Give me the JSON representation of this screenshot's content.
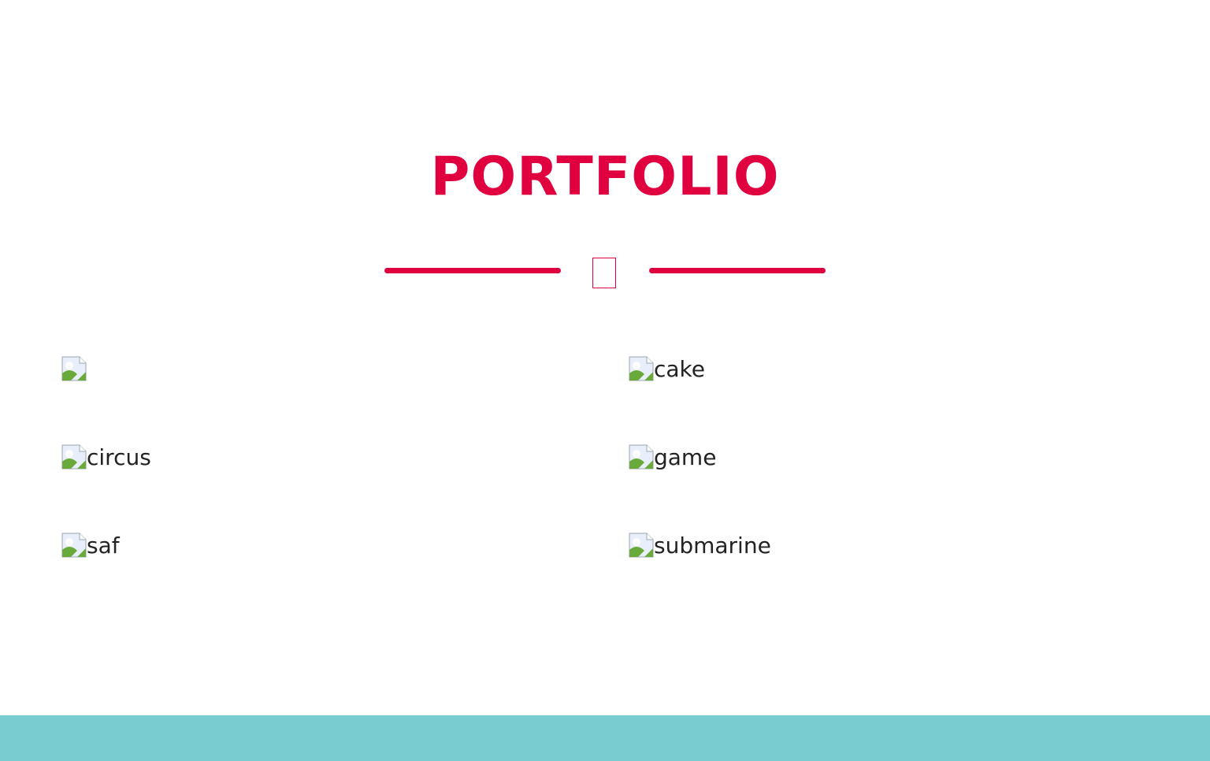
{
  "portfolio": {
    "title": "PORTFOLIO",
    "divider_icon": "tofu-glyph-icon",
    "items": [
      {
        "caption": "",
        "icon": "broken-image-icon"
      },
      {
        "caption": "cake",
        "icon": "broken-image-icon"
      },
      {
        "caption": "circus",
        "icon": "broken-image-icon"
      },
      {
        "caption": "game",
        "icon": "broken-image-icon"
      },
      {
        "caption": "saf",
        "icon": "broken-image-icon"
      },
      {
        "caption": "submarine",
        "icon": "broken-image-icon"
      }
    ]
  },
  "colors": {
    "accent": "#e00040",
    "footer": "#79cdd1",
    "text": "#222222",
    "background": "#ffffff"
  }
}
